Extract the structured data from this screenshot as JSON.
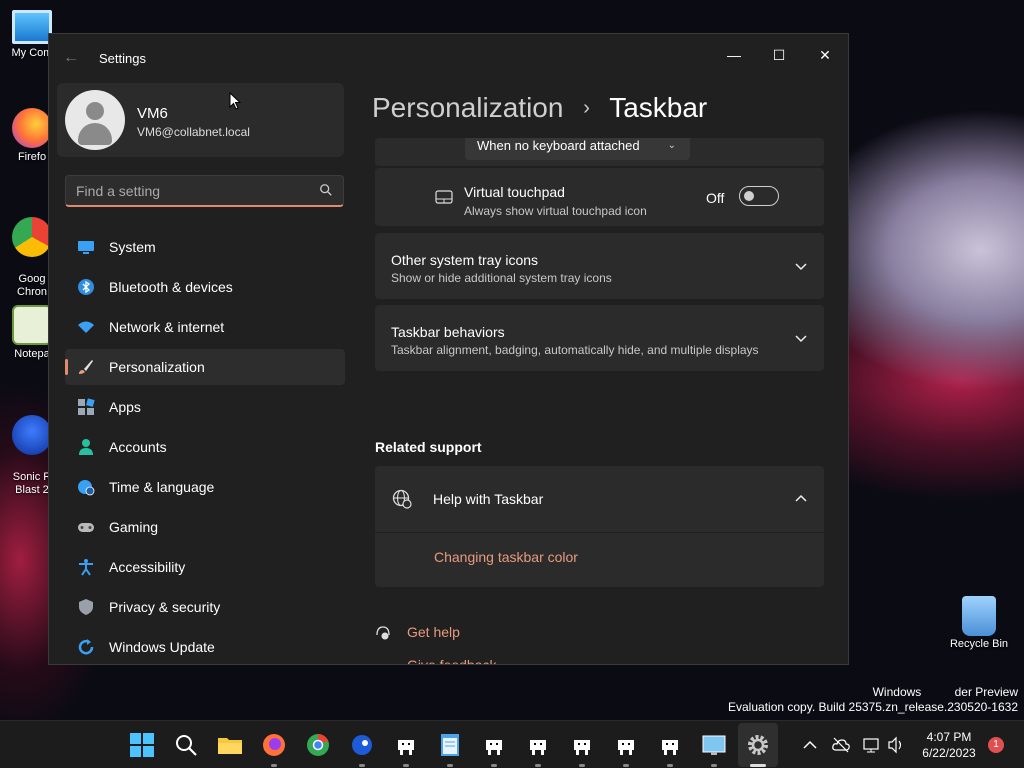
{
  "desktop": {
    "icons": [
      {
        "label": "My Com",
        "color": "#4aa3e8"
      },
      {
        "label": "Firefo",
        "color": "#ff7139"
      },
      {
        "label": "Goog\nChron",
        "color": "#34a853"
      },
      {
        "label": "Notepa",
        "color": "#8bc34a"
      },
      {
        "label": "Sonic R\nBlast 2",
        "color": "#1e5bd8"
      }
    ],
    "recycle_bin": "Recycle Bin",
    "watermark_line1": "Windows          der Preview",
    "watermark_line2": "Evaluation copy. Build 25375.zn_release.230520-1632"
  },
  "window": {
    "title": "Settings",
    "minimize": "—",
    "maximize": "☐",
    "close": "✕",
    "back": "←"
  },
  "sidebar": {
    "profile": {
      "name": "VM6",
      "email": "VM6@collabnet.local"
    },
    "search": {
      "placeholder": "Find a setting",
      "value": ""
    },
    "items": [
      {
        "label": "System",
        "icon": "monitor-icon",
        "color": "#3aa0f3"
      },
      {
        "label": "Bluetooth & devices",
        "icon": "bluetooth-icon",
        "color": "#2f8ee0"
      },
      {
        "label": "Network & internet",
        "icon": "wifi-icon",
        "color": "#3aa0f3"
      },
      {
        "label": "Personalization",
        "icon": "brush-icon",
        "color": "#e6a07a",
        "active": true
      },
      {
        "label": "Apps",
        "icon": "apps-icon",
        "color": "#9aa8b8"
      },
      {
        "label": "Accounts",
        "icon": "person-icon",
        "color": "#29c0a0"
      },
      {
        "label": "Time & language",
        "icon": "globe-clock-icon",
        "color": "#3aa0f3"
      },
      {
        "label": "Gaming",
        "icon": "gamepad-icon",
        "color": "#b8b8b8"
      },
      {
        "label": "Accessibility",
        "icon": "accessibility-icon",
        "color": "#3aa0f3"
      },
      {
        "label": "Privacy & security",
        "icon": "shield-icon",
        "color": "#9aa0a8"
      },
      {
        "label": "Windows Update",
        "icon": "update-icon",
        "color": "#3aa0f3"
      }
    ]
  },
  "header": {
    "parent": "Personalization",
    "separator": "›",
    "current": "Taskbar"
  },
  "content": {
    "dropdown_value": "When no keyboard attached",
    "virtual_touchpad": {
      "title": "Virtual touchpad",
      "subtitle": "Always show virtual touchpad icon",
      "state": "Off"
    },
    "other_tray": {
      "title": "Other system tray icons",
      "subtitle": "Show or hide additional system tray icons"
    },
    "behaviors": {
      "title": "Taskbar behaviors",
      "subtitle": "Taskbar alignment, badging, automatically hide, and multiple displays"
    },
    "related_support": "Related support",
    "help": {
      "title": "Help with Taskbar",
      "link": "Changing taskbar color"
    },
    "get_help": "Get help",
    "give_feedback": "Give feedback"
  },
  "taskbar": {
    "time": "4:07 PM",
    "date": "6/22/2023",
    "notification_count": "1",
    "accent": "#e08a6e"
  }
}
